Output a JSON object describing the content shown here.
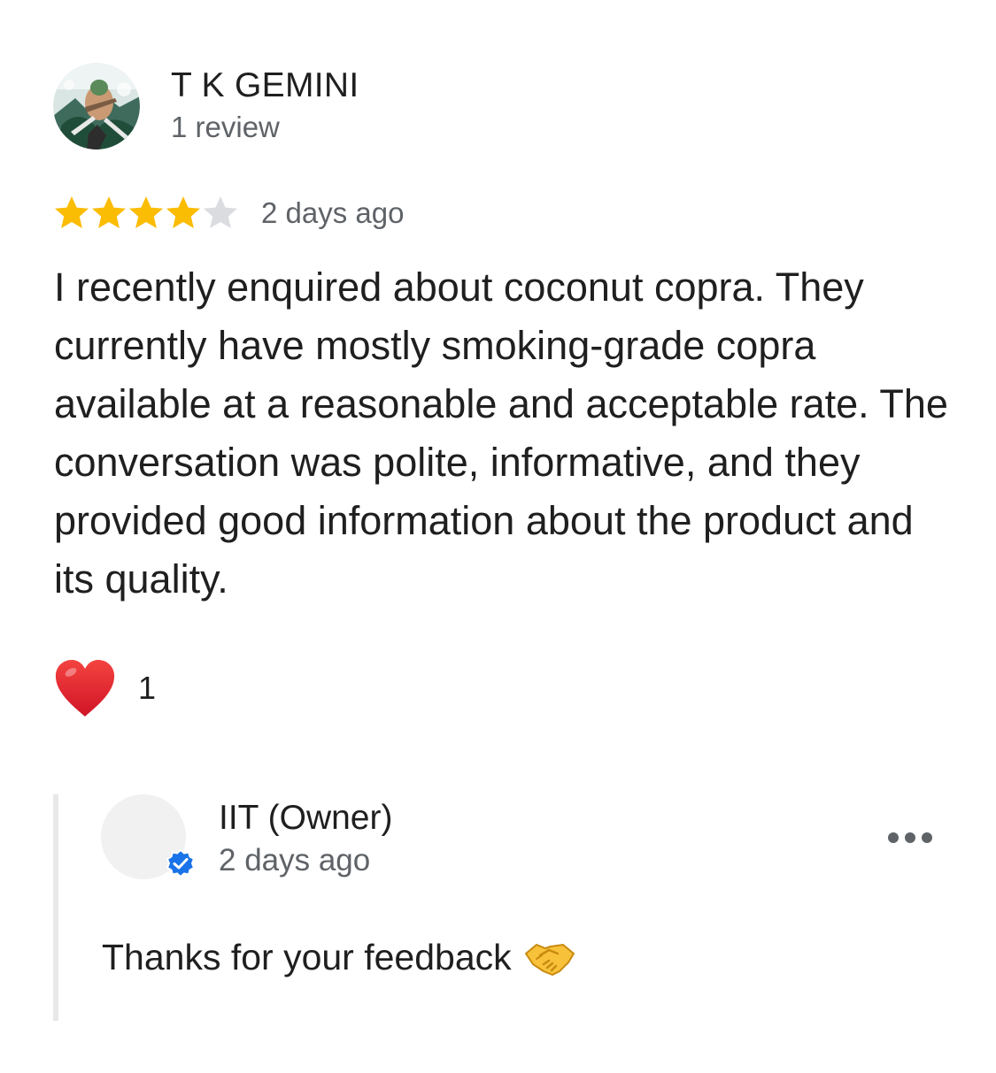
{
  "review": {
    "reviewer_name": "T K GEMINI",
    "reviewer_review_count": "1 review",
    "rating": 4,
    "rating_max": 5,
    "date": "2 days ago",
    "text": "I recently enquired about coconut copra. They currently have mostly smoking-grade copra available at a reasonable and acceptable rate. The conversation was polite, informative, and they provided good information about the product and its quality.",
    "reaction": {
      "icon": "heart-icon",
      "count": "1"
    }
  },
  "owner_reply": {
    "name": "IIT (Owner)",
    "verified_icon": "verified-badge-icon",
    "date": "2 days ago",
    "text": "Thanks for your feedback",
    "emoji_icon": "handshake-icon",
    "menu_icon": "more-options-icon"
  },
  "colors": {
    "star_filled": "#fbbc04",
    "star_empty": "#dadce0",
    "secondary_text": "#5f6368",
    "verified_blue": "#1a73e8",
    "heart_red": "#e5202e"
  }
}
